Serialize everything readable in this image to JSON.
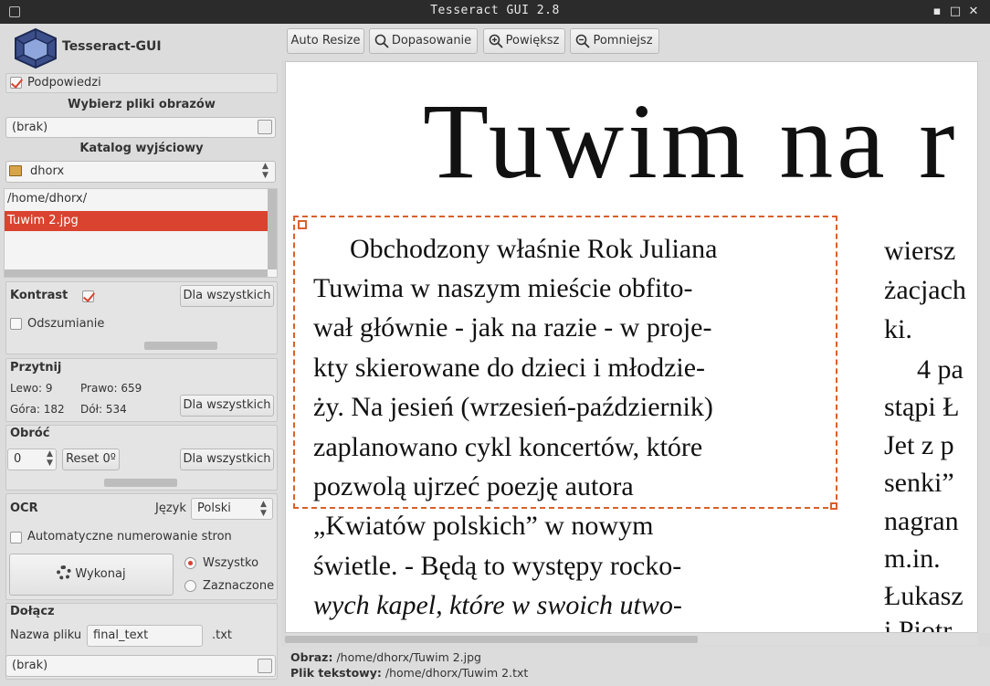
{
  "window": {
    "title": "Tesseract GUI 2.8",
    "min": "▪",
    "max": "□",
    "close": "✕"
  },
  "app": {
    "name": "Tesseract-GUI"
  },
  "hints": {
    "label": "Podpowiedzi",
    "checked": true
  },
  "files": {
    "heading": "Wybierz pliki obrazów",
    "value": "(brak)"
  },
  "output_dir": {
    "heading": "Katalog wyjściowy",
    "value": "dhorx"
  },
  "file_list": {
    "items": [
      "/home/dhorx/",
      "Tuwim 2.jpg"
    ],
    "selected": 1
  },
  "contrast": {
    "label": "Kontrast",
    "checked": true,
    "apply_all": "Dla wszystkich",
    "denoise_label": "Odszumianie",
    "denoise_checked": false
  },
  "crop": {
    "heading": "Przytnij",
    "left": "Lewo: 9",
    "right": "Prawo: 659",
    "top": "Góra: 182",
    "bottom": "Dół: 534",
    "apply_all": "Dla wszystkich"
  },
  "rotate": {
    "heading": "Obróć",
    "value": "0",
    "reset": "Reset 0º",
    "apply_all": "Dla wszystkich"
  },
  "ocr": {
    "heading": "OCR",
    "lang_label": "Język",
    "lang_value": "Polski",
    "autonum_label": "Automatyczne numerowanie stron",
    "autonum_checked": false,
    "run": "Wykonaj",
    "all": "Wszystko",
    "selected": "Zaznaczone",
    "mode": "all"
  },
  "join": {
    "heading": "Dołącz",
    "filename_label": "Nazwa pliku",
    "filename_value": "final_text",
    "ext": ".txt",
    "value": "(brak)"
  },
  "toolbar": {
    "auto_resize": "Auto Resize",
    "fit": "Dopasowanie",
    "zoom_in": "Powiększ",
    "zoom_out": "Pomniejsz"
  },
  "scan": {
    "headline": "Tuwim na r",
    "lines": [
      "Obchodzony właśnie Rok Juliana",
      "Tuwima w naszym mieście obfito-",
      "wał głównie - jak na razie - w proje-",
      "kty skierowane do dzieci i młodzie-",
      "ży. Na jesień (wrzesień-październik)",
      "zaplanowano cykl koncertów, które",
      "pozwolą  ujrzeć  poezję  autora",
      "„Kwiatów  polskich”  w  nowym",
      "świetle. - Będą to występy rocko-",
      "wych kapel, które w swoich utwo-"
    ],
    "right_col": [
      "wiersz",
      "żacjach",
      "ki.",
      "4 pa",
      "stąpi Ł",
      "Jet z p",
      "senki”",
      "nagran",
      "m.in.",
      "Łukasz",
      "i Piotr"
    ]
  },
  "status": {
    "image_label": "Obraz:",
    "image_path": "/home/dhorx/Tuwim 2.jpg",
    "text_label": "Plik tekstowy:",
    "text_path": "/home/dhorx/Tuwim 2.txt"
  }
}
